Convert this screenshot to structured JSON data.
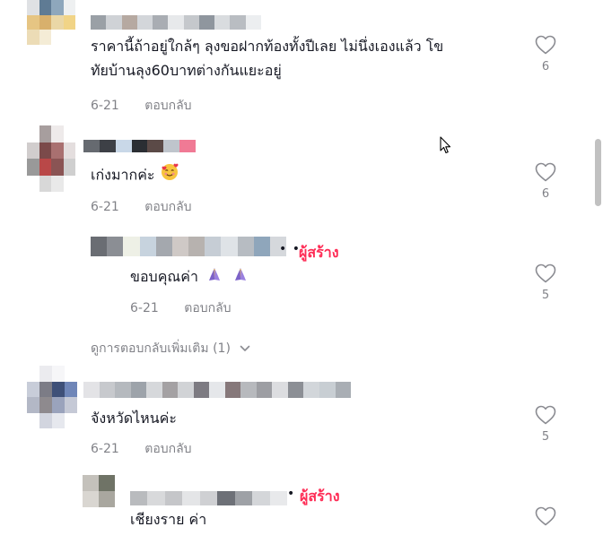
{
  "comments": [
    {
      "text_lines": [
        "ราคานี้ถ้าอยู่ใกล้ๆ ลุงขอฝากท้องทั้งปีเลย ไม่นึ่งเองแล้ว โข",
        "ทัยบ้านลุง60บาทต่างกันแยะอยู่"
      ],
      "date": "6-21",
      "reply_label": "ตอบกลับ",
      "like_count": "6"
    },
    {
      "text": "เก่งมากค่ะ",
      "emoji": "smiling-face-with-hearts",
      "date": "6-21",
      "reply_label": "ตอบกลับ",
      "like_count": "6",
      "reply": {
        "creator_label": "ผู้สร้าง",
        "dots": "• •",
        "text": "ขอบคุณค่า",
        "emoji": "folded-hands",
        "date": "6-21",
        "reply_label": "ตอบกลับ",
        "like_count": "5"
      },
      "more_replies": "ดูการตอบกลับเพิ่มเติม (1)"
    },
    {
      "text": "จังหวัดไหนค่ะ",
      "date": "6-21",
      "reply_label": "ตอบกลับ",
      "like_count": "5",
      "reply": {
        "creator_label": "ผู้สร้าง",
        "dots": "•",
        "text": "เชียงราย ค่า"
      }
    }
  ],
  "colors": {
    "text": "#161823",
    "muted": "#8a8b91",
    "creator": "#fe2c55",
    "heart_outline": "#8a8b91"
  }
}
